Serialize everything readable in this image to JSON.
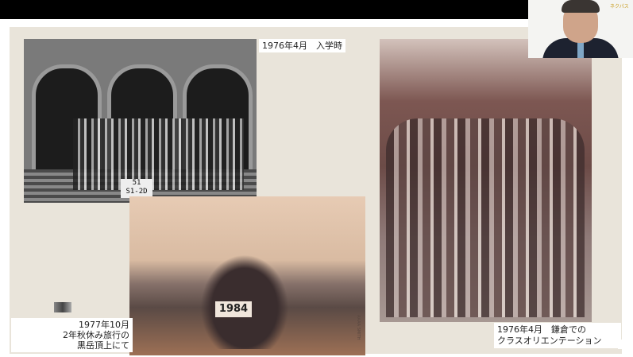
{
  "slide": {
    "photo_1": {
      "sign_text_line1": "51",
      "sign_text_line2": "S1-2D"
    },
    "photo_2": {
      "sign_text": "1984",
      "stamp_text": "AAAA SMITH"
    },
    "captions": {
      "entrance_1976": "1976年4月　入学時",
      "autumn_trip_1977_line1": "1977年10月",
      "autumn_trip_1977_line2": "2年秋休み旅行の",
      "autumn_trip_1977_line3": "黒岳頂上にて",
      "kamakura_1976_line1": "1976年4月　鎌倉での",
      "kamakura_1976_line2": "クラスオリエンテーション"
    }
  },
  "webcam": {
    "logo_text": "ネクパス"
  }
}
